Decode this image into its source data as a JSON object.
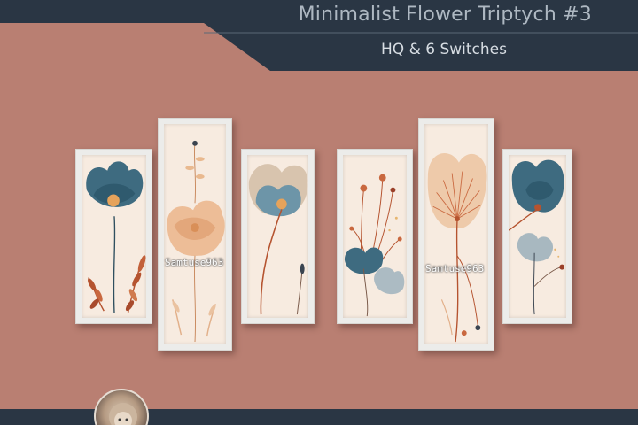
{
  "header": {
    "title": "Minimalist Flower Triptych #3",
    "subtitle": "HQ & 6 Switches"
  },
  "watermark": "Samtuse963",
  "frames": [
    {
      "icon": "teal-poppy-icon"
    },
    {
      "icon": "peach-flower-icon"
    },
    {
      "icon": "blue-beige-flower-icon"
    },
    {
      "icon": "dandelion-berries-icon"
    },
    {
      "icon": "peach-dandelion-icon"
    },
    {
      "icon": "teal-flower-icon"
    }
  ],
  "colors": {
    "background": "#b97f72",
    "band": "#2a3644",
    "teal": "#3e6b80",
    "peach": "#e9b98f",
    "rust": "#b5532f"
  }
}
